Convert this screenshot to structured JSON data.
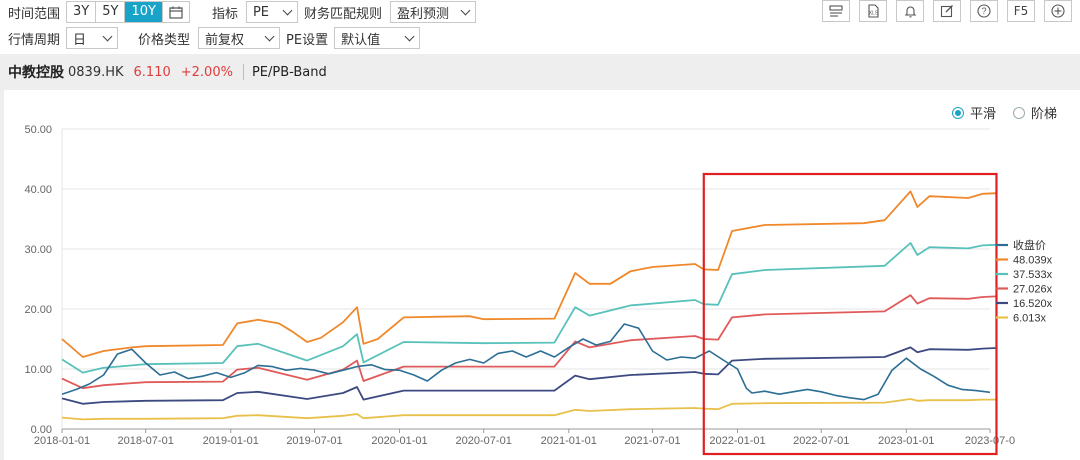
{
  "toolbar": {
    "time_range_label": "时间范围",
    "range_buttons": [
      "3Y",
      "5Y",
      "10Y"
    ],
    "active_range": "10Y",
    "indicator_label": "指标",
    "indicator_value": "PE",
    "finance_rule_label": "财务匹配规则",
    "finance_rule_value": "盈利预测",
    "period_label": "行情周期",
    "period_value": "日",
    "price_type_label": "价格类型",
    "price_type_value": "前复权",
    "pe_setting_label": "PE设置",
    "pe_setting_value": "默认值",
    "icons": [
      "layout-icon",
      "excel-icon",
      "bell-icon",
      "edit-icon",
      "help-icon",
      "f5-icon",
      "add-icon"
    ],
    "f5_label": "F5"
  },
  "stock": {
    "name": "中教控股",
    "code": "0839.HK",
    "price": "6.110",
    "change": "+2.00%",
    "view": "PE/PB-Band",
    "up_color": "#e03c3c"
  },
  "modes": {
    "smooth": "平滑",
    "step": "阶梯",
    "selected": "smooth"
  },
  "chart_data": {
    "type": "line",
    "x_ticks": [
      "2018-01-01",
      "2018-07-01",
      "2019-01-01",
      "2019-07-01",
      "2020-01-01",
      "2020-07-01",
      "2021-01-01",
      "2021-07-01",
      "2022-01-01",
      "2022-07-01",
      "2023-01-01",
      "2023-07-0"
    ],
    "y_ticks": [
      "0.00",
      "10.00",
      "20.00",
      "30.00",
      "40.00",
      "50.00"
    ],
    "ylim": [
      0,
      50
    ],
    "xlim": [
      "2018-01-01",
      "2023-07-01"
    ],
    "grid": "horizontal",
    "legend_position": "right",
    "highlight_box": {
      "from": "2021-10-20",
      "to": "2023-07-15",
      "color": "#e02020"
    },
    "series": [
      {
        "name": "收盘价",
        "color": "#2c6e94",
        "points": [
          [
            "2018-01-01",
            5.8
          ],
          [
            "2018-02-01",
            6.6
          ],
          [
            "2018-03-01",
            7.5
          ],
          [
            "2018-04-01",
            9.0
          ],
          [
            "2018-05-01",
            12.5
          ],
          [
            "2018-06-01",
            13.3
          ],
          [
            "2018-07-01",
            11.0
          ],
          [
            "2018-08-01",
            9.0
          ],
          [
            "2018-09-01",
            9.5
          ],
          [
            "2018-10-01",
            8.4
          ],
          [
            "2018-11-01",
            8.8
          ],
          [
            "2018-12-01",
            9.4
          ],
          [
            "2019-01-01",
            8.6
          ],
          [
            "2019-02-01",
            9.4
          ],
          [
            "2019-03-01",
            10.6
          ],
          [
            "2019-04-01",
            10.4
          ],
          [
            "2019-05-01",
            9.8
          ],
          [
            "2019-06-01",
            10.1
          ],
          [
            "2019-07-01",
            9.8
          ],
          [
            "2019-08-01",
            9.2
          ],
          [
            "2019-09-01",
            9.8
          ],
          [
            "2019-10-01",
            10.4
          ],
          [
            "2019-11-01",
            10.7
          ],
          [
            "2019-12-01",
            9.9
          ],
          [
            "2020-01-01",
            9.8
          ],
          [
            "2020-02-01",
            9.0
          ],
          [
            "2020-03-01",
            8.0
          ],
          [
            "2020-04-01",
            9.8
          ],
          [
            "2020-05-01",
            11.0
          ],
          [
            "2020-06-01",
            11.6
          ],
          [
            "2020-07-01",
            11.0
          ],
          [
            "2020-08-01",
            12.6
          ],
          [
            "2020-09-01",
            13.0
          ],
          [
            "2020-10-01",
            12.0
          ],
          [
            "2020-11-01",
            13.0
          ],
          [
            "2020-12-01",
            12.0
          ],
          [
            "2021-01-01",
            13.6
          ],
          [
            "2021-02-01",
            15.0
          ],
          [
            "2021-03-01",
            14.0
          ],
          [
            "2021-04-01",
            14.6
          ],
          [
            "2021-05-01",
            17.5
          ],
          [
            "2021-06-01",
            16.8
          ],
          [
            "2021-07-01",
            13.0
          ],
          [
            "2021-08-01",
            11.5
          ],
          [
            "2021-09-01",
            12.0
          ],
          [
            "2021-10-01",
            11.8
          ],
          [
            "2021-11-01",
            13.0
          ],
          [
            "2021-12-01",
            11.5
          ],
          [
            "2022-01-01",
            10.0
          ],
          [
            "2022-01-20",
            6.8
          ],
          [
            "2022-02-01",
            6.0
          ],
          [
            "2022-03-01",
            6.3
          ],
          [
            "2022-04-01",
            5.8
          ],
          [
            "2022-05-01",
            6.2
          ],
          [
            "2022-06-01",
            6.6
          ],
          [
            "2022-07-01",
            6.2
          ],
          [
            "2022-08-01",
            5.6
          ],
          [
            "2022-09-01",
            5.2
          ],
          [
            "2022-10-01",
            4.9
          ],
          [
            "2022-11-01",
            5.8
          ],
          [
            "2022-12-01",
            9.8
          ],
          [
            "2023-01-01",
            11.8
          ],
          [
            "2023-02-01",
            10.0
          ],
          [
            "2023-03-01",
            8.8
          ],
          [
            "2023-04-01",
            7.3
          ],
          [
            "2023-05-01",
            6.6
          ],
          [
            "2023-06-01",
            6.4
          ],
          [
            "2023-07-01",
            6.11
          ]
        ]
      },
      {
        "name": "48.039x",
        "color": "#f0882a",
        "points": [
          [
            "2018-01-01",
            15.0
          ],
          [
            "2018-02-15",
            12.0
          ],
          [
            "2018-04-01",
            13.0
          ],
          [
            "2018-06-01",
            13.6
          ],
          [
            "2018-07-01",
            13.8
          ],
          [
            "2018-12-15",
            14.0
          ],
          [
            "2019-01-15",
            17.6
          ],
          [
            "2019-03-01",
            18.2
          ],
          [
            "2019-04-15",
            17.6
          ],
          [
            "2019-05-15",
            16.2
          ],
          [
            "2019-06-15",
            14.5
          ],
          [
            "2019-07-15",
            15.2
          ],
          [
            "2019-09-01",
            17.8
          ],
          [
            "2019-10-01",
            20.3
          ],
          [
            "2019-10-15",
            14.2
          ],
          [
            "2019-11-15",
            15.0
          ],
          [
            "2020-01-10",
            18.6
          ],
          [
            "2020-06-01",
            18.8
          ],
          [
            "2020-07-01",
            18.3
          ],
          [
            "2020-12-01",
            18.4
          ],
          [
            "2021-01-15",
            26.0
          ],
          [
            "2021-02-15",
            24.2
          ],
          [
            "2021-04-01",
            24.2
          ],
          [
            "2021-05-15",
            26.3
          ],
          [
            "2021-07-01",
            27.0
          ],
          [
            "2021-10-01",
            27.5
          ],
          [
            "2021-10-20",
            26.6
          ],
          [
            "2021-11-20",
            26.5
          ],
          [
            "2021-12-20",
            33.0
          ],
          [
            "2022-03-01",
            34.0
          ],
          [
            "2022-10-01",
            34.3
          ],
          [
            "2022-11-15",
            34.8
          ],
          [
            "2023-01-10",
            39.6
          ],
          [
            "2023-01-25",
            37.0
          ],
          [
            "2023-02-20",
            38.8
          ],
          [
            "2023-05-15",
            38.5
          ],
          [
            "2023-06-15",
            39.2
          ],
          [
            "2023-07-15",
            39.3
          ]
        ]
      },
      {
        "name": "37.533x",
        "color": "#58c1ba",
        "points": [
          [
            "2018-01-01",
            11.6
          ],
          [
            "2018-02-15",
            9.4
          ],
          [
            "2018-04-01",
            10.2
          ],
          [
            "2018-06-01",
            10.6
          ],
          [
            "2018-07-01",
            10.8
          ],
          [
            "2018-12-15",
            11.0
          ],
          [
            "2019-01-15",
            13.8
          ],
          [
            "2019-03-01",
            14.2
          ],
          [
            "2019-06-15",
            11.4
          ],
          [
            "2019-09-01",
            13.8
          ],
          [
            "2019-10-01",
            15.8
          ],
          [
            "2019-10-15",
            11.1
          ],
          [
            "2020-01-10",
            14.5
          ],
          [
            "2020-07-01",
            14.3
          ],
          [
            "2020-12-01",
            14.4
          ],
          [
            "2021-01-15",
            20.3
          ],
          [
            "2021-02-15",
            18.9
          ],
          [
            "2021-05-15",
            20.6
          ],
          [
            "2021-10-01",
            21.5
          ],
          [
            "2021-10-20",
            20.8
          ],
          [
            "2021-11-20",
            20.7
          ],
          [
            "2021-12-20",
            25.8
          ],
          [
            "2022-03-01",
            26.5
          ],
          [
            "2022-11-15",
            27.2
          ],
          [
            "2023-01-10",
            31.0
          ],
          [
            "2023-01-25",
            29.0
          ],
          [
            "2023-02-20",
            30.3
          ],
          [
            "2023-05-15",
            30.1
          ],
          [
            "2023-06-15",
            30.6
          ],
          [
            "2023-07-15",
            30.7
          ]
        ]
      },
      {
        "name": "27.026x",
        "color": "#e05a5a",
        "points": [
          [
            "2018-01-01",
            8.4
          ],
          [
            "2018-02-15",
            6.8
          ],
          [
            "2018-04-01",
            7.3
          ],
          [
            "2018-07-01",
            7.8
          ],
          [
            "2018-12-15",
            7.9
          ],
          [
            "2019-01-15",
            9.9
          ],
          [
            "2019-03-01",
            10.2
          ],
          [
            "2019-06-15",
            8.2
          ],
          [
            "2019-09-01",
            9.9
          ],
          [
            "2019-10-01",
            11.4
          ],
          [
            "2019-10-15",
            8.0
          ],
          [
            "2020-01-10",
            10.4
          ],
          [
            "2020-12-01",
            10.4
          ],
          [
            "2021-01-15",
            14.6
          ],
          [
            "2021-02-15",
            13.6
          ],
          [
            "2021-05-15",
            14.8
          ],
          [
            "2021-10-01",
            15.5
          ],
          [
            "2021-10-20",
            15.0
          ],
          [
            "2021-11-20",
            14.9
          ],
          [
            "2021-12-20",
            18.6
          ],
          [
            "2022-03-01",
            19.1
          ],
          [
            "2022-11-15",
            19.6
          ],
          [
            "2023-01-10",
            22.3
          ],
          [
            "2023-01-25",
            20.9
          ],
          [
            "2023-02-20",
            21.8
          ],
          [
            "2023-05-15",
            21.7
          ],
          [
            "2023-06-15",
            22.0
          ],
          [
            "2023-07-15",
            22.1
          ]
        ]
      },
      {
        "name": "16.520x",
        "color": "#3d4a82",
        "points": [
          [
            "2018-01-01",
            5.1
          ],
          [
            "2018-02-15",
            4.2
          ],
          [
            "2018-04-01",
            4.5
          ],
          [
            "2018-07-01",
            4.7
          ],
          [
            "2018-12-15",
            4.8
          ],
          [
            "2019-01-15",
            6.0
          ],
          [
            "2019-03-01",
            6.2
          ],
          [
            "2019-06-15",
            5.0
          ],
          [
            "2019-09-01",
            6.0
          ],
          [
            "2019-10-01",
            7.0
          ],
          [
            "2019-10-15",
            4.9
          ],
          [
            "2020-01-10",
            6.4
          ],
          [
            "2020-12-01",
            6.4
          ],
          [
            "2021-01-15",
            8.9
          ],
          [
            "2021-02-15",
            8.3
          ],
          [
            "2021-05-15",
            9.0
          ],
          [
            "2021-10-01",
            9.5
          ],
          [
            "2021-10-20",
            9.2
          ],
          [
            "2021-11-20",
            9.1
          ],
          [
            "2021-12-20",
            11.4
          ],
          [
            "2022-03-01",
            11.7
          ],
          [
            "2022-11-15",
            12.0
          ],
          [
            "2023-01-10",
            13.6
          ],
          [
            "2023-01-25",
            12.8
          ],
          [
            "2023-02-20",
            13.3
          ],
          [
            "2023-05-15",
            13.2
          ],
          [
            "2023-06-15",
            13.4
          ],
          [
            "2023-07-15",
            13.5
          ]
        ]
      },
      {
        "name": "6.013x",
        "color": "#e8c04a",
        "points": [
          [
            "2018-01-01",
            1.9
          ],
          [
            "2018-02-15",
            1.6
          ],
          [
            "2018-04-01",
            1.7
          ],
          [
            "2018-07-01",
            1.7
          ],
          [
            "2018-12-15",
            1.8
          ],
          [
            "2019-01-15",
            2.2
          ],
          [
            "2019-03-01",
            2.3
          ],
          [
            "2019-06-15",
            1.8
          ],
          [
            "2019-09-01",
            2.2
          ],
          [
            "2019-10-01",
            2.5
          ],
          [
            "2019-10-15",
            1.8
          ],
          [
            "2020-01-10",
            2.3
          ],
          [
            "2020-12-01",
            2.3
          ],
          [
            "2021-01-15",
            3.2
          ],
          [
            "2021-02-15",
            3.0
          ],
          [
            "2021-05-15",
            3.3
          ],
          [
            "2021-10-01",
            3.5
          ],
          [
            "2021-10-20",
            3.4
          ],
          [
            "2021-11-20",
            3.3
          ],
          [
            "2021-12-20",
            4.2
          ],
          [
            "2022-03-01",
            4.3
          ],
          [
            "2022-11-15",
            4.4
          ],
          [
            "2023-01-10",
            5.0
          ],
          [
            "2023-01-25",
            4.7
          ],
          [
            "2023-02-20",
            4.8
          ],
          [
            "2023-05-15",
            4.8
          ],
          [
            "2023-06-15",
            4.9
          ],
          [
            "2023-07-15",
            4.9
          ]
        ]
      }
    ]
  }
}
